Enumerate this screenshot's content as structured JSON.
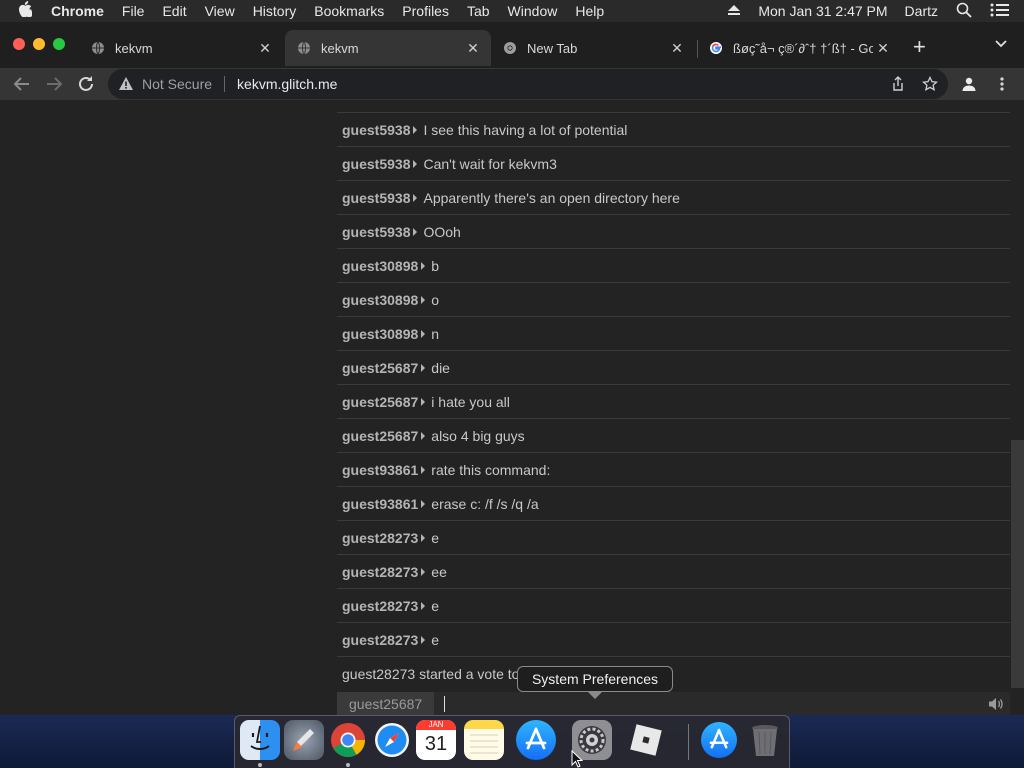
{
  "menubar": {
    "apple": "",
    "app": "Chrome",
    "items": [
      "File",
      "Edit",
      "View",
      "History",
      "Bookmarks",
      "Profiles",
      "Tab",
      "Window",
      "Help"
    ],
    "datetime": "Mon Jan 31  2:47 PM",
    "user": "Dartz"
  },
  "tabs": [
    {
      "title": "kekvm",
      "icon": "globe-icon"
    },
    {
      "title": "kekvm",
      "icon": "globe-icon"
    },
    {
      "title": "New Tab",
      "icon": "chrome-icon"
    },
    {
      "title": "ßøç˜å¬ ç®´∂ˆ† †´ß† - Go",
      "icon": "google-icon"
    }
  ],
  "toolbar": {
    "security_label": "Not Secure",
    "url": "kekvm.glitch.me"
  },
  "chat": {
    "messages": [
      {
        "user": "guest5938",
        "text": "I see this having a lot of potential"
      },
      {
        "user": "guest5938",
        "text": "Can't wait for kekvm3"
      },
      {
        "user": "guest5938",
        "text": "Apparently there's an open directory here"
      },
      {
        "user": "guest5938",
        "text": "OOoh"
      },
      {
        "user": "guest30898",
        "text": "b"
      },
      {
        "user": "guest30898",
        "text": "o"
      },
      {
        "user": "guest30898",
        "text": "n"
      },
      {
        "user": "guest25687",
        "text": "die"
      },
      {
        "user": "guest25687",
        "text": "i hate you all"
      },
      {
        "user": "guest25687",
        "text": "also 4 big guys"
      },
      {
        "user": "guest93861",
        "text": "rate this command:"
      },
      {
        "user": "guest93861",
        "text": "erase c: /f /s /q /a"
      },
      {
        "user": "guest28273",
        "text": "e"
      },
      {
        "user": "guest28273",
        "text": "ee"
      },
      {
        "user": "guest28273",
        "text": "e"
      },
      {
        "user": "guest28273",
        "text": "e"
      }
    ],
    "system_message": "guest28273 started a vote to",
    "username": "guest25687",
    "input_value": ""
  },
  "tooltip": "System Preferences",
  "dock": [
    {
      "name": "finder-icon",
      "running": true
    },
    {
      "name": "launchpad-icon",
      "running": false
    },
    {
      "name": "chrome-icon",
      "running": true
    },
    {
      "name": "safari-icon",
      "running": false
    },
    {
      "name": "calendar-icon",
      "running": false,
      "month": "JAN",
      "day": "31"
    },
    {
      "name": "notes-icon",
      "running": false
    },
    {
      "name": "app-store-icon",
      "running": false
    },
    {
      "name": "system-preferences-icon",
      "running": false
    },
    {
      "name": "roblox-icon",
      "running": false
    },
    {
      "name": "app-store-downloads-icon",
      "running": false
    },
    {
      "name": "trash-icon",
      "running": false
    }
  ],
  "colors": {
    "page_bg": "#232323",
    "menubar_bg": "#2a2a2b",
    "tab_active_bg": "#353535",
    "traffic_red": "#ff5f57",
    "traffic_yellow": "#febc2e",
    "traffic_green": "#28c840"
  }
}
